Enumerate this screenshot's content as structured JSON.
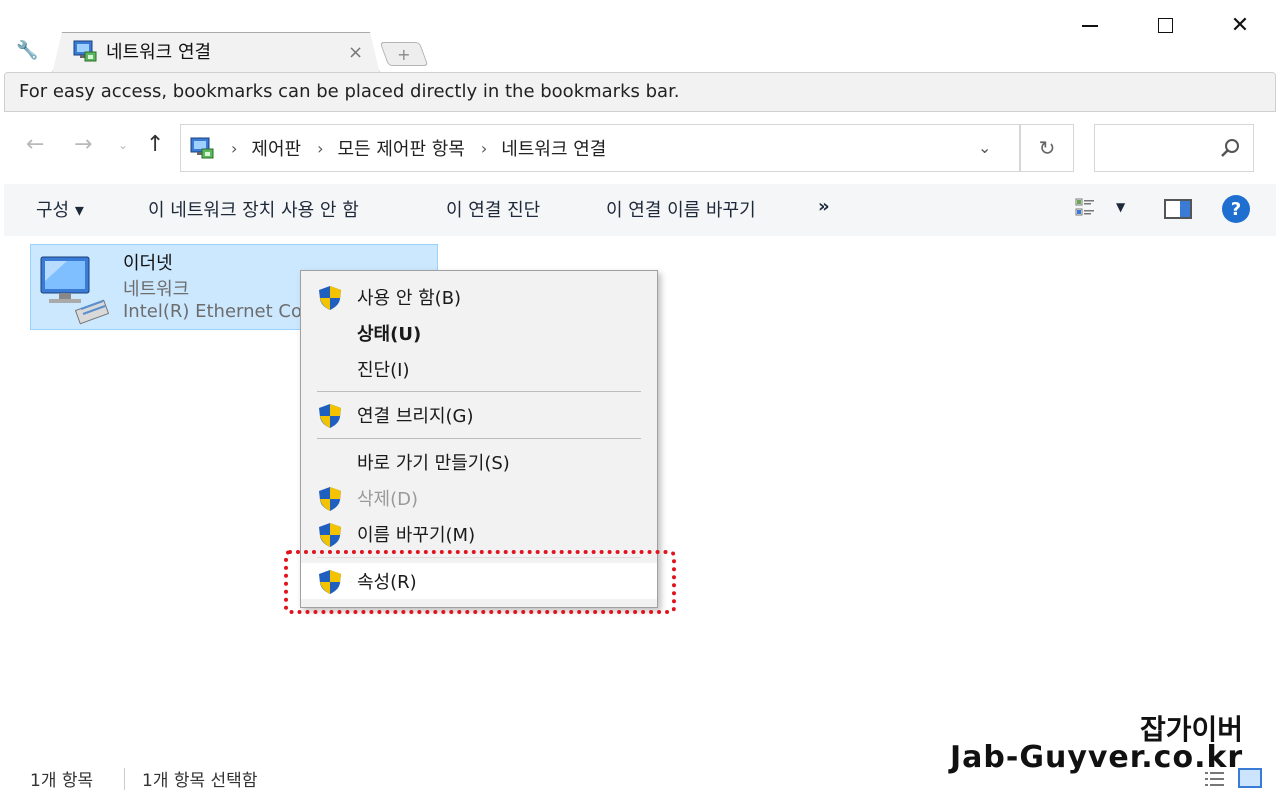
{
  "window": {
    "minimize_icon": "minimize-icon",
    "maximize_icon": "maximize-icon",
    "close_symbol": "✕"
  },
  "tabs": {
    "active_title": "네트워크 연결",
    "close_symbol": "×",
    "new_tab_symbol": "+"
  },
  "bookmarks_bar": {
    "hint": "For easy access, bookmarks can be placed directly in the bookmarks bar."
  },
  "nav": {
    "back_symbol": "←",
    "forward_symbol": "→",
    "recent_symbol": "⌄",
    "up_symbol": "↑",
    "breadcrumb": [
      "제어판",
      "모든 제어판 항목",
      "네트워크 연결"
    ],
    "breadcrumb_sep": "›",
    "dropdown_symbol": "⌄",
    "refresh_symbol": "↻"
  },
  "commands": {
    "organize": "구성 ▾",
    "disable": "이 네트워크 장치 사용 안 함",
    "diagnose": "이 연결 진단",
    "rename": "이 연결 이름 바꾸기",
    "more": "»",
    "view_dropdown": "▼",
    "help": "?"
  },
  "item": {
    "name": "이더넷",
    "status": "네트워크",
    "device": "Intel(R) Ethernet Cor"
  },
  "context_menu": {
    "items": [
      {
        "label": "사용 안 함(B)",
        "shield": true
      },
      {
        "label": "상태(U)",
        "bold": true
      },
      {
        "label": "진단(I)"
      },
      {
        "label": "연결 브리지(G)",
        "shield": true
      },
      {
        "label": "바로 가기 만들기(S)"
      },
      {
        "label": "삭제(D)",
        "shield": true,
        "disabled": true
      },
      {
        "label": "이름 바꾸기(M)",
        "shield": true
      },
      {
        "label": "속성(R)",
        "shield": true,
        "highlighted": true
      }
    ]
  },
  "status_bar": {
    "count": "1개 항목",
    "selected": "1개 항목 선택함"
  },
  "watermark": {
    "line1": "잡가이버",
    "line2": "Jab-Guyver.co.kr"
  },
  "colors": {
    "selection_bg": "#cce8ff",
    "highlight_border": "#e0141c",
    "shield_blue": "#1f5fbf",
    "shield_yellow": "#f3c300"
  }
}
